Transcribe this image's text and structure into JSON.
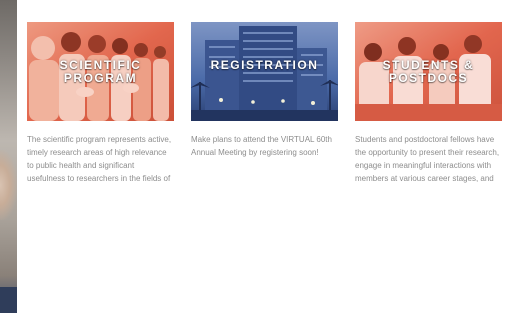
{
  "cards": [
    {
      "title_line1": "SCIENTIFIC",
      "title_line2": "PROGRAM",
      "description": "The scientific program represents active, timely research areas of high relevance to public health and significant usefulness to researchers in the fields of birth defects research",
      "image_icon": "audience-clapping-photo",
      "tint": "#e2674e"
    },
    {
      "title_line1": "REGISTRATION",
      "title_line2": "",
      "description": "Make plans to attend the VIRTUAL 60th Annual Meeting by registering soon!",
      "image_icon": "hotel-building-photo",
      "tint": "#4a6aa8"
    },
    {
      "title_line1": "STUDENTS &",
      "title_line2": "POSTDOCS",
      "description": "Students and postdoctoral fellows have the opportunity to present their research, engage in meaningful interactions with members at various career stages, and network with peers",
      "image_icon": "lab-students-photo",
      "tint": "#e2674e"
    }
  ]
}
